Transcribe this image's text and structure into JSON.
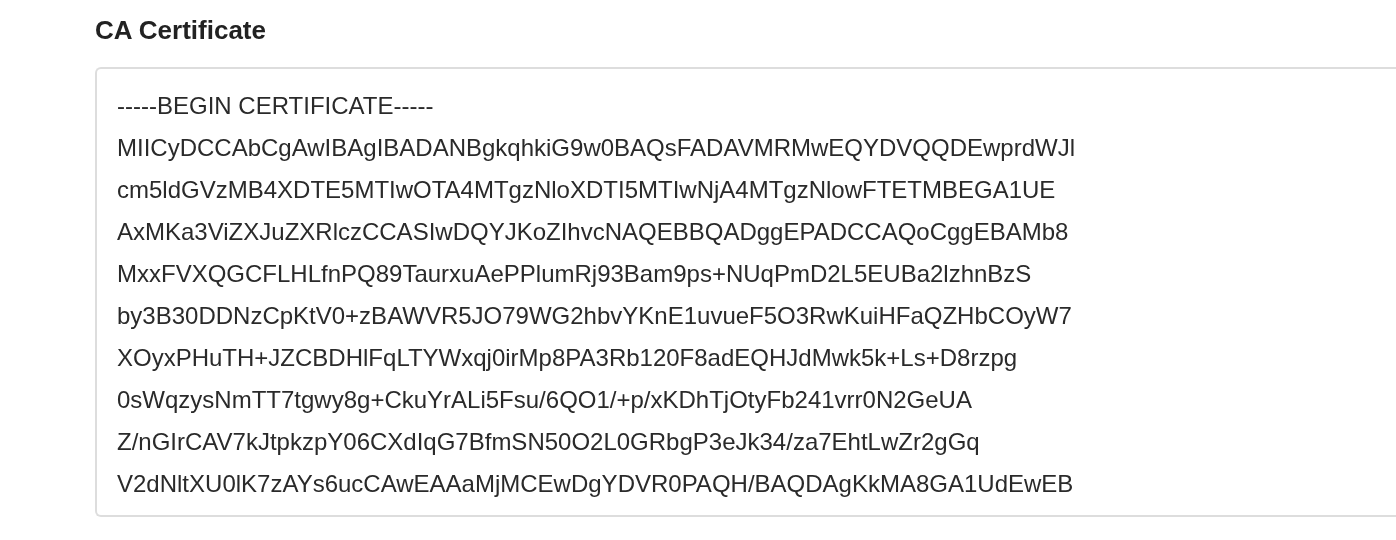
{
  "label": "CA Certificate",
  "certificate_field": {
    "value": "-----BEGIN CERTIFICATE-----\nMIICyDCCAbCgAwIBAgIBADANBgkqhkiG9w0BAQsFADAVMRMwEQYDVQQDEwprdWJl\ncm5ldGVzMB4XDTE5MTIwOTA4MTgzNloXDTI5MTIwNjA4MTgzNlowFTETMBEGA1UE\nAxMKa3ViZXJuZXRlczCCASIwDQYJKoZIhvcNAQEBBQADggEPADCCAQoCggEBAMb8\nMxxFVXQGCFLHLfnPQ89TaurxuAePPlumRj93Bam9ps+NUqPmD2L5EUBa2lzhnBzS\nby3B30DDNzCpKtV0+zBAWVR5JO79WG2hbvYKnE1uvueF5O3RwKuiHFaQZHbCOyW7\nXOyxPHuTH+JZCBDHlFqLTYWxqj0irMp8PA3Rb120F8adEQHJdMwk5k+Ls+D8rzpg\n0sWqzysNmTT7tgwy8g+CkuYrALi5Fsu/6QO1/+p/xKDhTjOtyFb241vrr0N2GeUA\nZ/nGIrCAV7kJtpkzpY06CXdIqG7BfmSN50O2L0GRbgP3eJk34/za7EhtLwZr2gGq\nV2dNltXU0lK7zAYs6ucCAwEAAaMjMCEwDgYDVR0PAQH/BAQDAgKkMA8GA1UdEwEB"
  }
}
